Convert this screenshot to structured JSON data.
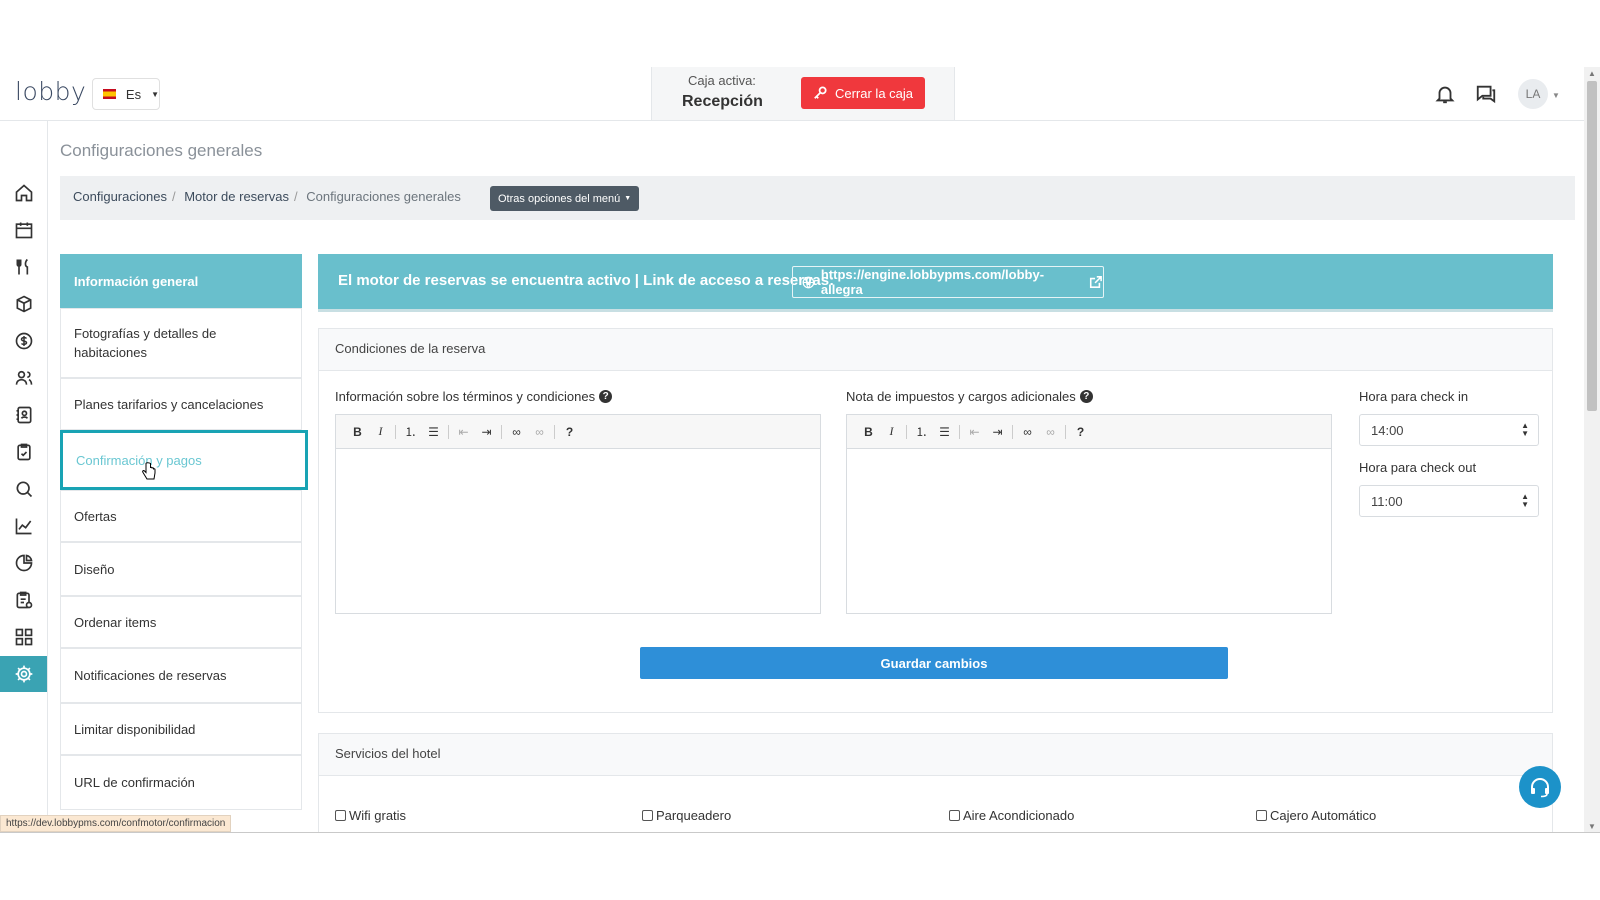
{
  "header": {
    "logo": "lobby",
    "language": "Es",
    "caja_label": "Caja activa:",
    "caja_value": "Recepción",
    "close_button": "Cerrar la caja",
    "avatar": "LA"
  },
  "rail": {
    "icons": [
      "home-icon",
      "calendar-icon",
      "utensils-icon",
      "box-icon",
      "dollar-icon",
      "users-icon",
      "contacts-icon",
      "clipboard-icon",
      "search-icon",
      "chart-line-icon",
      "pie-chart-icon",
      "clipboard-check-icon",
      "grid-icon",
      "gear-icon"
    ],
    "active": "gear-icon"
  },
  "page": {
    "title": "Configuraciones generales",
    "breadcrumb": [
      "Configuraciones",
      "Motor de reservas",
      "Configuraciones generales"
    ],
    "other_options": "Otras opciones del menú"
  },
  "menu": {
    "items": [
      "Información general",
      "Fotografías y detalles de habitaciones",
      "Planes tarifarios y cancelaciones",
      "Confirmación y pagos",
      "Ofertas",
      "Diseño",
      "Ordenar items",
      "Notificaciones de reservas",
      "Limitar disponibilidad",
      "URL de confirmación"
    ],
    "active_index": 0,
    "hovered_index": 3
  },
  "banner": {
    "text": "El motor de reservas se encuentra activo | Link de acceso a reservas:",
    "link": "https://engine.lobbypms.com/lobby-allegra"
  },
  "conditions": {
    "title": "Condiciones de la reserva",
    "terms_label": "Información sobre los términos y condiciones",
    "taxes_label": "Nota de impuestos y cargos adicionales",
    "checkin_label": "Hora para check in",
    "checkin_value": "14:00",
    "checkout_label": "Hora para check out",
    "checkout_value": "11:00",
    "save_button": "Guardar cambios",
    "toolbar": [
      "B",
      "I",
      "ordered-list-icon",
      "unordered-list-icon",
      "outdent-icon",
      "indent-icon",
      "link-icon",
      "unlink-icon",
      "?"
    ]
  },
  "services": {
    "title": "Servicios del hotel",
    "items": [
      "Wifi gratis",
      "Parqueadero",
      "Aire Acondicionado",
      "Cajero Automático"
    ]
  },
  "status_bar": {
    "url": "https://dev.lobbypms.com/confmotor/confirmacion"
  },
  "colors": {
    "accent": "#69bfcc",
    "danger": "#f0383d",
    "primary": "#2e8fd8",
    "rail_active": "#3aa3b3"
  }
}
